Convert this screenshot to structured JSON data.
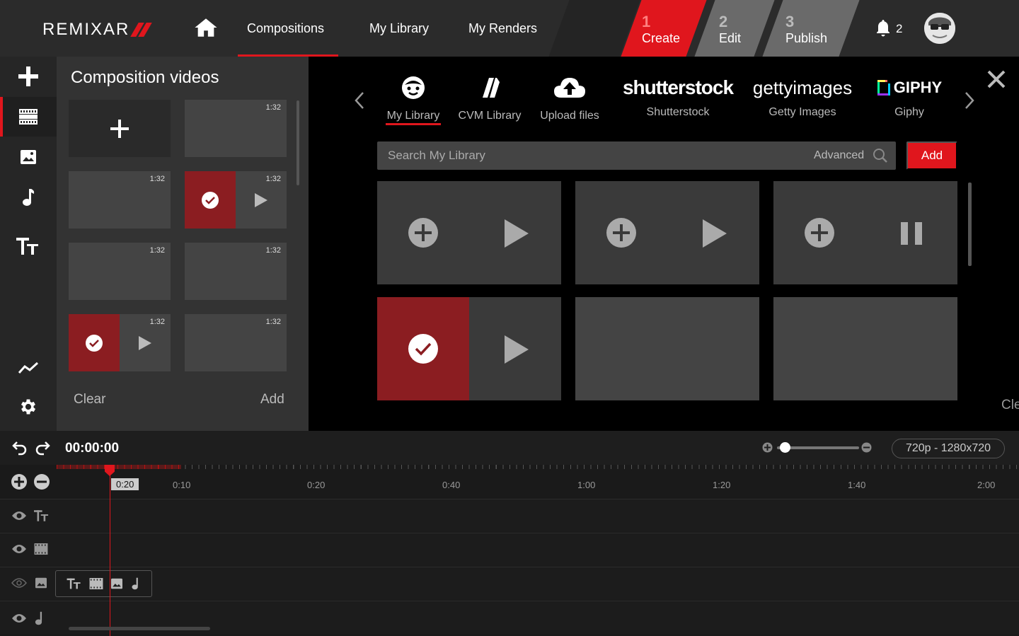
{
  "app": {
    "logo": "REMIXAR"
  },
  "nav": {
    "items": [
      "Compositions",
      "My Library",
      "My Renders"
    ],
    "active": "Compositions"
  },
  "steps": [
    {
      "num": "1",
      "label": "Create",
      "active": true
    },
    {
      "num": "2",
      "label": "Edit",
      "active": false
    },
    {
      "num": "3",
      "label": "Publish",
      "active": false
    }
  ],
  "notifications": {
    "count": "2"
  },
  "composition": {
    "title": "Composition videos",
    "durations": [
      "1:32",
      "1:32",
      "1:32",
      "1:32",
      "1:32",
      "1:32",
      "1:32"
    ],
    "clear_label": "Clear",
    "add_label": "Add"
  },
  "sources": {
    "tabs": [
      {
        "label": "My Library",
        "icon": "smiley-face-icon"
      },
      {
        "label": "CVM Library",
        "icon": "cvm-slash-icon"
      },
      {
        "label": "Upload files",
        "icon": "cloud-upload-icon"
      },
      {
        "label": "Shutterstock",
        "logo": "shutterstock"
      },
      {
        "label": "Getty Images",
        "logo": "gettyimages"
      },
      {
        "label": "Giphy",
        "logo": "GIPHY"
      }
    ],
    "active": "My Library"
  },
  "search": {
    "placeholder": "Search My Library",
    "advanced_label": "Advanced",
    "add_label": "Add"
  },
  "media_panel": {
    "cut_text": "Cle"
  },
  "timeline": {
    "time": "00:00:00",
    "resolution": "720p - 1280x720",
    "ticks": [
      "0:10",
      "0:20",
      "0:40",
      "1:00",
      "1:20",
      "1:40",
      "2:00"
    ],
    "current_tick": "0:20"
  },
  "colors": {
    "accent": "#e0161d",
    "selected": "#8b1d21",
    "panel": "#333333"
  }
}
